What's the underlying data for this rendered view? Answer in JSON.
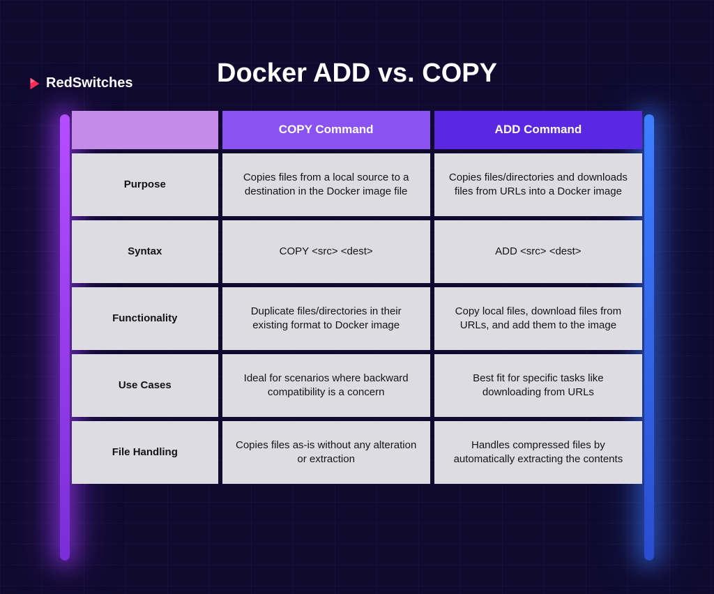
{
  "brand": "RedSwitches",
  "title": "Docker ADD vs. COPY",
  "headers": {
    "blank": "",
    "copy": "COPY Command",
    "add": "ADD Command"
  },
  "rows": [
    {
      "label": "Purpose",
      "copy": "Copies files from a local source to a destination in the Docker image file",
      "add": "Copies files/directories and downloads files from URLs into a Docker image"
    },
    {
      "label": "Syntax",
      "copy": "COPY <src> <dest>",
      "add": "ADD <src> <dest>"
    },
    {
      "label": "Functionality",
      "copy": "Duplicate files/directories in their existing format to Docker image",
      "add": "Copy local files, download files from URLs, and add them to the image"
    },
    {
      "label": "Use Cases",
      "copy": "Ideal for scenarios where backward compatibility is a concern",
      "add": "Best fit for specific tasks like downloading from URLs"
    },
    {
      "label": "File Handling",
      "copy": "Copies files as-is without any alteration or extraction",
      "add": "Handles compressed files by automatically extracting the contents"
    }
  ]
}
